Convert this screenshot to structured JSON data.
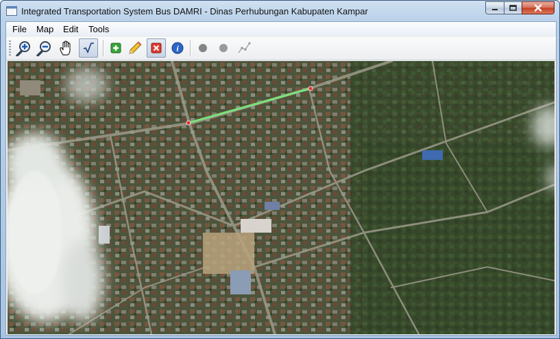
{
  "window": {
    "title": "Integrated Transportation System Bus DAMRI - Dinas Perhubungan Kabupaten Kampar"
  },
  "menu": [
    {
      "label": "File"
    },
    {
      "label": "Map"
    },
    {
      "label": "Edit"
    },
    {
      "label": "Tools"
    }
  ],
  "toolbar": {
    "buttons": [
      {
        "icon": "zoom-in-icon"
      },
      {
        "icon": "zoom-out-icon"
      },
      {
        "icon": "hand-pan-icon"
      },
      {
        "icon": "measure-icon",
        "active": true
      },
      {
        "icon": "add-icon"
      },
      {
        "icon": "pencil-icon"
      },
      {
        "icon": "delete-icon",
        "active": true
      },
      {
        "icon": "info-icon"
      },
      {
        "icon": "point-gray-icon"
      },
      {
        "icon": "point-gray-icon"
      },
      {
        "icon": "route-icon"
      }
    ]
  },
  "map": {
    "type": "satellite",
    "route_color": "#7be07b",
    "marker_color": "#e03030"
  },
  "colors": {
    "accent": "#3a5a7c",
    "close": "#c33f22"
  }
}
